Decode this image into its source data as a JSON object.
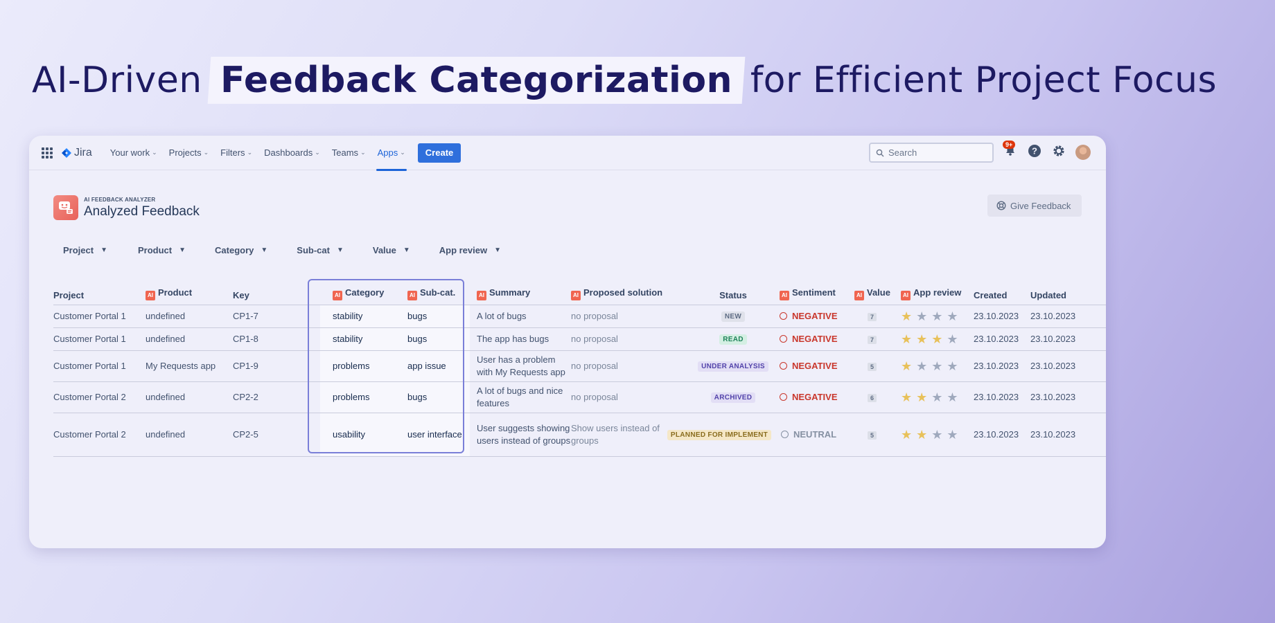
{
  "headline": {
    "prefix": "AI-Driven",
    "highlight": "Feedback Categorization",
    "suffix": "for Efficient Project Focus"
  },
  "topnav": {
    "logo": "Jira",
    "items": [
      {
        "label": "Your work"
      },
      {
        "label": "Projects"
      },
      {
        "label": "Filters"
      },
      {
        "label": "Dashboards"
      },
      {
        "label": "Teams"
      },
      {
        "label": "Apps"
      }
    ],
    "active_item": "Apps",
    "create_label": "Create",
    "search_placeholder": "Search",
    "notification_badge": "9+",
    "accent_color": "#2f6fdc"
  },
  "app": {
    "kicker": "AI FEEDBACK ANALYZER",
    "title": "Analyzed Feedback",
    "feedback_button": "Give Feedback"
  },
  "filters": [
    "Project",
    "Product",
    "Category",
    "Sub-cat",
    "Value",
    "App review"
  ],
  "table": {
    "ai_tag": "AI",
    "columns": {
      "project": "Project",
      "product": "Product",
      "key": "Key",
      "category": "Category",
      "subcat": "Sub-cat.",
      "summary": "Summary",
      "proposed": "Proposed solution",
      "status": "Status",
      "sentiment": "Sentiment",
      "value": "Value",
      "review": "App review",
      "created": "Created",
      "updated": "Updated"
    },
    "rows": [
      {
        "project": "Customer Portal 1",
        "product": "undefined",
        "key": "CP1-7",
        "category": "stability",
        "subcat": "bugs",
        "summary": "A lot of bugs",
        "proposed": "no proposal",
        "status": "NEW",
        "sentiment": "NEGATIVE",
        "value": "7",
        "stars": 1,
        "created": "23.10.2023",
        "updated": "23.10.2023"
      },
      {
        "project": "Customer Portal 1",
        "product": "undefined",
        "key": "CP1-8",
        "category": "stability",
        "subcat": "bugs",
        "summary": "The app has bugs",
        "proposed": "no proposal",
        "status": "READ",
        "sentiment": "NEGATIVE",
        "value": "7",
        "stars": 3,
        "created": "23.10.2023",
        "updated": "23.10.2023"
      },
      {
        "project": "Customer Portal 1",
        "product": "My Requests app",
        "key": "CP1-9",
        "category": "problems",
        "subcat": "app issue",
        "summary": "User has a problem with My Requests app",
        "proposed": "no proposal",
        "status": "UNDER ANALYSIS",
        "sentiment": "NEGATIVE",
        "value": "5",
        "stars": 1,
        "created": "23.10.2023",
        "updated": "23.10.2023"
      },
      {
        "project": "Customer Portal 2",
        "product": "undefined",
        "key": "CP2-2",
        "category": "problems",
        "subcat": "bugs",
        "summary": "A lot of bugs and nice features",
        "proposed": "no proposal",
        "status": "ARCHIVED",
        "sentiment": "NEGATIVE",
        "value": "6",
        "stars": 2,
        "created": "23.10.2023",
        "updated": "23.10.2023"
      },
      {
        "project": "Customer Portal 2",
        "product": "undefined",
        "key": "CP2-5",
        "category": "usability",
        "subcat": "user interface",
        "summary": "User suggests showing users instead of groups",
        "proposed": "Show users instead of groups",
        "status": "PLANNED FOR IMPLEMENT",
        "sentiment": "NEUTRAL",
        "value": "5",
        "stars": 2,
        "created": "23.10.2023",
        "updated": "23.10.2023"
      }
    ]
  }
}
